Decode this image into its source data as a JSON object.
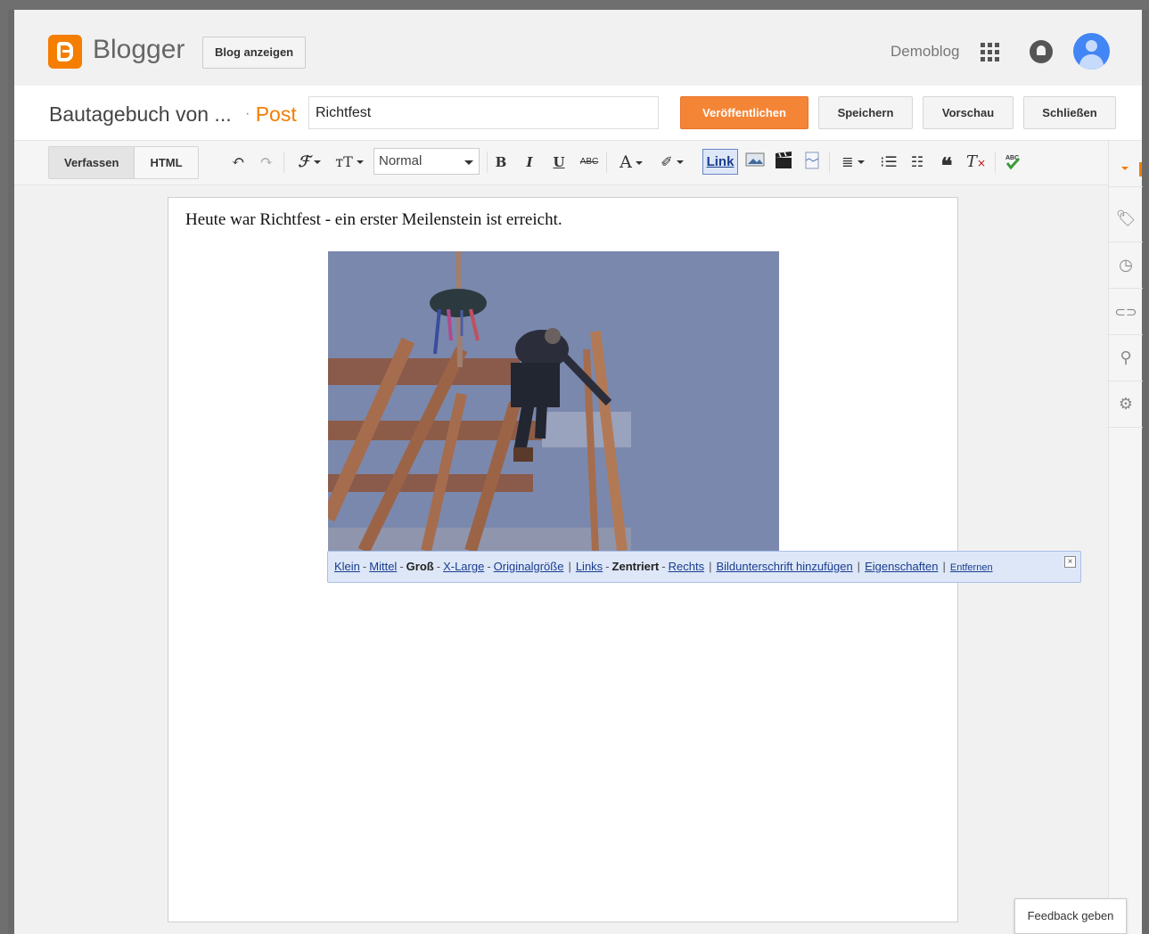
{
  "header": {
    "logo_text": "Blogger",
    "view_blog_label": "Blog anzeigen",
    "blog_name": "Demoblog"
  },
  "titlebar": {
    "blog_title": "Bautagebuch von ...",
    "post_label": "Post",
    "post_title_value": "Richtfest",
    "publish_label": "Veröffentlichen",
    "save_label": "Speichern",
    "preview_label": "Vorschau",
    "close_label": "Schließen"
  },
  "toolbar": {
    "compose_label": "Verfassen",
    "html_label": "HTML",
    "font_size_value": "Normal",
    "bold": "B",
    "italic": "I",
    "underline": "U",
    "strikethrough": "ABC",
    "text_color": "A",
    "link_label": "Link"
  },
  "editor": {
    "body_text": "Heute war Richtfest - ein erster Meilenstein ist erreicht."
  },
  "image_bar": {
    "klein": "Klein",
    "mittel": "Mittel",
    "gross": "Groß",
    "xlarge": "X-Large",
    "original": "Originalgröße",
    "links": "Links",
    "zentriert": "Zentriert",
    "rechts": "Rechts",
    "caption": "Bildunterschrift hinzufügen",
    "properties": "Eigenschaften",
    "remove": "Entfernen",
    "close": "×"
  },
  "feedback_label": "Feedback geben",
  "colors": {
    "brand_orange": "#f57d00",
    "publish_orange": "#f58536",
    "link_blue": "#1a3d8f",
    "avatar_blue": "#4285f4"
  },
  "icons": {
    "undo": "undo-icon",
    "redo": "redo-icon",
    "font": "font-family-icon",
    "font_size": "font-size-icon",
    "highlight": "highlight-icon",
    "image": "insert-image-icon",
    "video": "insert-video-icon",
    "jump_break": "jump-break-icon",
    "align": "align-icon",
    "numbered_list": "numbered-list-icon",
    "bullet_list": "bullet-list-icon",
    "quote": "quote-icon",
    "clear_format": "clear-format-icon",
    "spellcheck": "spellcheck-icon",
    "labels": "tag-icon",
    "schedule": "clock-icon",
    "permalink": "link-icon",
    "location": "location-icon",
    "options": "gear-icon"
  }
}
